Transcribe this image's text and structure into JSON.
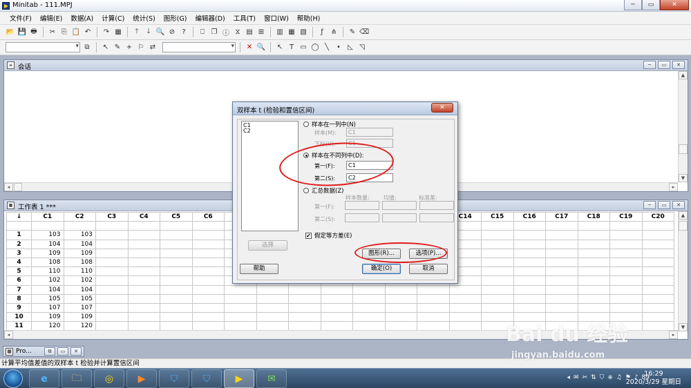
{
  "window": {
    "title": "Minitab - 111.MPJ",
    "minimize": "─",
    "maximize": "▭",
    "close": "✕"
  },
  "menu": [
    "文件(F)",
    "编辑(E)",
    "数据(A)",
    "计算(C)",
    "统计(S)",
    "图形(G)",
    "编辑器(D)",
    "工具(T)",
    "窗口(W)",
    "帮助(H)"
  ],
  "toolbar1_icons": [
    "open-icon",
    "save-icon",
    "print-icon",
    "cut-icon",
    "copy-icon",
    "paste-icon",
    "undo-icon",
    "redo-icon",
    "worksheet-icon",
    "up-arrow-icon",
    "down-arrow-icon",
    "find-icon",
    "cancel-icon",
    "help-icon",
    "session-icon",
    "window-icon",
    "info-icon",
    "history-icon",
    "graph-icon",
    "layout-icon",
    "grid-icon",
    "table-icon",
    "report-icon",
    "formula-icon",
    "tree-icon",
    "brush-icon",
    "eraser-icon"
  ],
  "toolbar1_glyphs": [
    "📂",
    "💾",
    "🖶",
    "✂",
    "⎘",
    "📋",
    "↶",
    "↷",
    "▦",
    "🡑",
    "🡓",
    "🔍",
    "⊘",
    "?",
    "⎕",
    "❐",
    "ⓘ",
    "⧖",
    "▤",
    "⊞",
    "▥",
    "▦",
    "▧",
    "ƒ",
    "⋔",
    "✎",
    "⌫"
  ],
  "toolbar2": {
    "combo1": "",
    "combo2": "",
    "glyphs": [
      "↖",
      "✎",
      "+",
      "⚐",
      "⇄",
      "✕",
      "🔍",
      "↖",
      "T",
      "▭",
      "◯",
      "╲",
      "•",
      "◺",
      "◹"
    ]
  },
  "session": {
    "title": "会话",
    "icon_text": "≡"
  },
  "worksheet": {
    "title": "工作表 1 ***",
    "corner": "↓",
    "columns": [
      "C1",
      "C2",
      "C3",
      "C4",
      "C5",
      "C6",
      "C7",
      "C8",
      "C9",
      "C10",
      "C11",
      "C12",
      "C13",
      "C14",
      "C15",
      "C16",
      "C17",
      "C18",
      "C19",
      "C20"
    ],
    "rows": [
      {
        "n": "1",
        "c1": "103",
        "c2": "103"
      },
      {
        "n": "2",
        "c1": "104",
        "c2": "104"
      },
      {
        "n": "3",
        "c1": "109",
        "c2": "109"
      },
      {
        "n": "4",
        "c1": "108",
        "c2": "108"
      },
      {
        "n": "5",
        "c1": "110",
        "c2": "110"
      },
      {
        "n": "6",
        "c1": "102",
        "c2": "102"
      },
      {
        "n": "7",
        "c1": "104",
        "c2": "104"
      },
      {
        "n": "8",
        "c1": "105",
        "c2": "105"
      },
      {
        "n": "9",
        "c1": "107",
        "c2": "107"
      },
      {
        "n": "10",
        "c1": "109",
        "c2": "109"
      },
      {
        "n": "11",
        "c1": "120",
        "c2": "120"
      }
    ]
  },
  "minimized": {
    "label": "Pro..."
  },
  "status": "计算平均值差值的双样本 t 检验并计算置信区间",
  "dialog": {
    "title": "双样本 t (检验和置信区间)",
    "close": "✕",
    "listbox_items": [
      "C1",
      "C2"
    ],
    "opt_one_column": "样本在一列中(N)",
    "samples_label": "样本(M):",
    "samples_value": "C1",
    "subscripts_label": "下标(U):",
    "subscripts_value": "C1",
    "opt_diff_columns": "样本在不同列中(D):",
    "first_label": "第一(F):",
    "first_value": "C1",
    "second_label": "第二(S):",
    "second_value": "C2",
    "opt_summary": "汇总数据(Z)",
    "n_label": "样本数量:",
    "mean_label": "均值:",
    "sd_label": "标准差:",
    "sum_first_label": "第一(F):",
    "sum_second_label": "第二(S):",
    "assume_equal": "假定等方差(E)",
    "check_mark": "✔",
    "btn_select": "选择",
    "btn_graphs": "图形(R)...",
    "btn_options": "选项(P)...",
    "btn_help": "帮助",
    "btn_ok": "确定(O)",
    "btn_cancel": "取消"
  },
  "taskbar": {
    "apps": [
      "ie-icon",
      "explorer-icon",
      "chrome-icon",
      "media-icon",
      "shield-icon",
      "shield-icon-2",
      "minitab-icon",
      "wechat-icon"
    ],
    "glyphs": [
      "e",
      "🗀",
      "◎",
      "▶",
      "⛉",
      "⛉",
      "▶",
      "✉"
    ],
    "tray": [
      "◂",
      "✉",
      "✂",
      "⇅",
      "⛉",
      "⎈",
      "♫",
      "⚑",
      "♪",
      "89"
    ],
    "time": "16:29",
    "date": "2020/3/29 星期日"
  },
  "watermark": {
    "brand": "Bai du 经验",
    "url": "jingyan.baidu.com"
  }
}
